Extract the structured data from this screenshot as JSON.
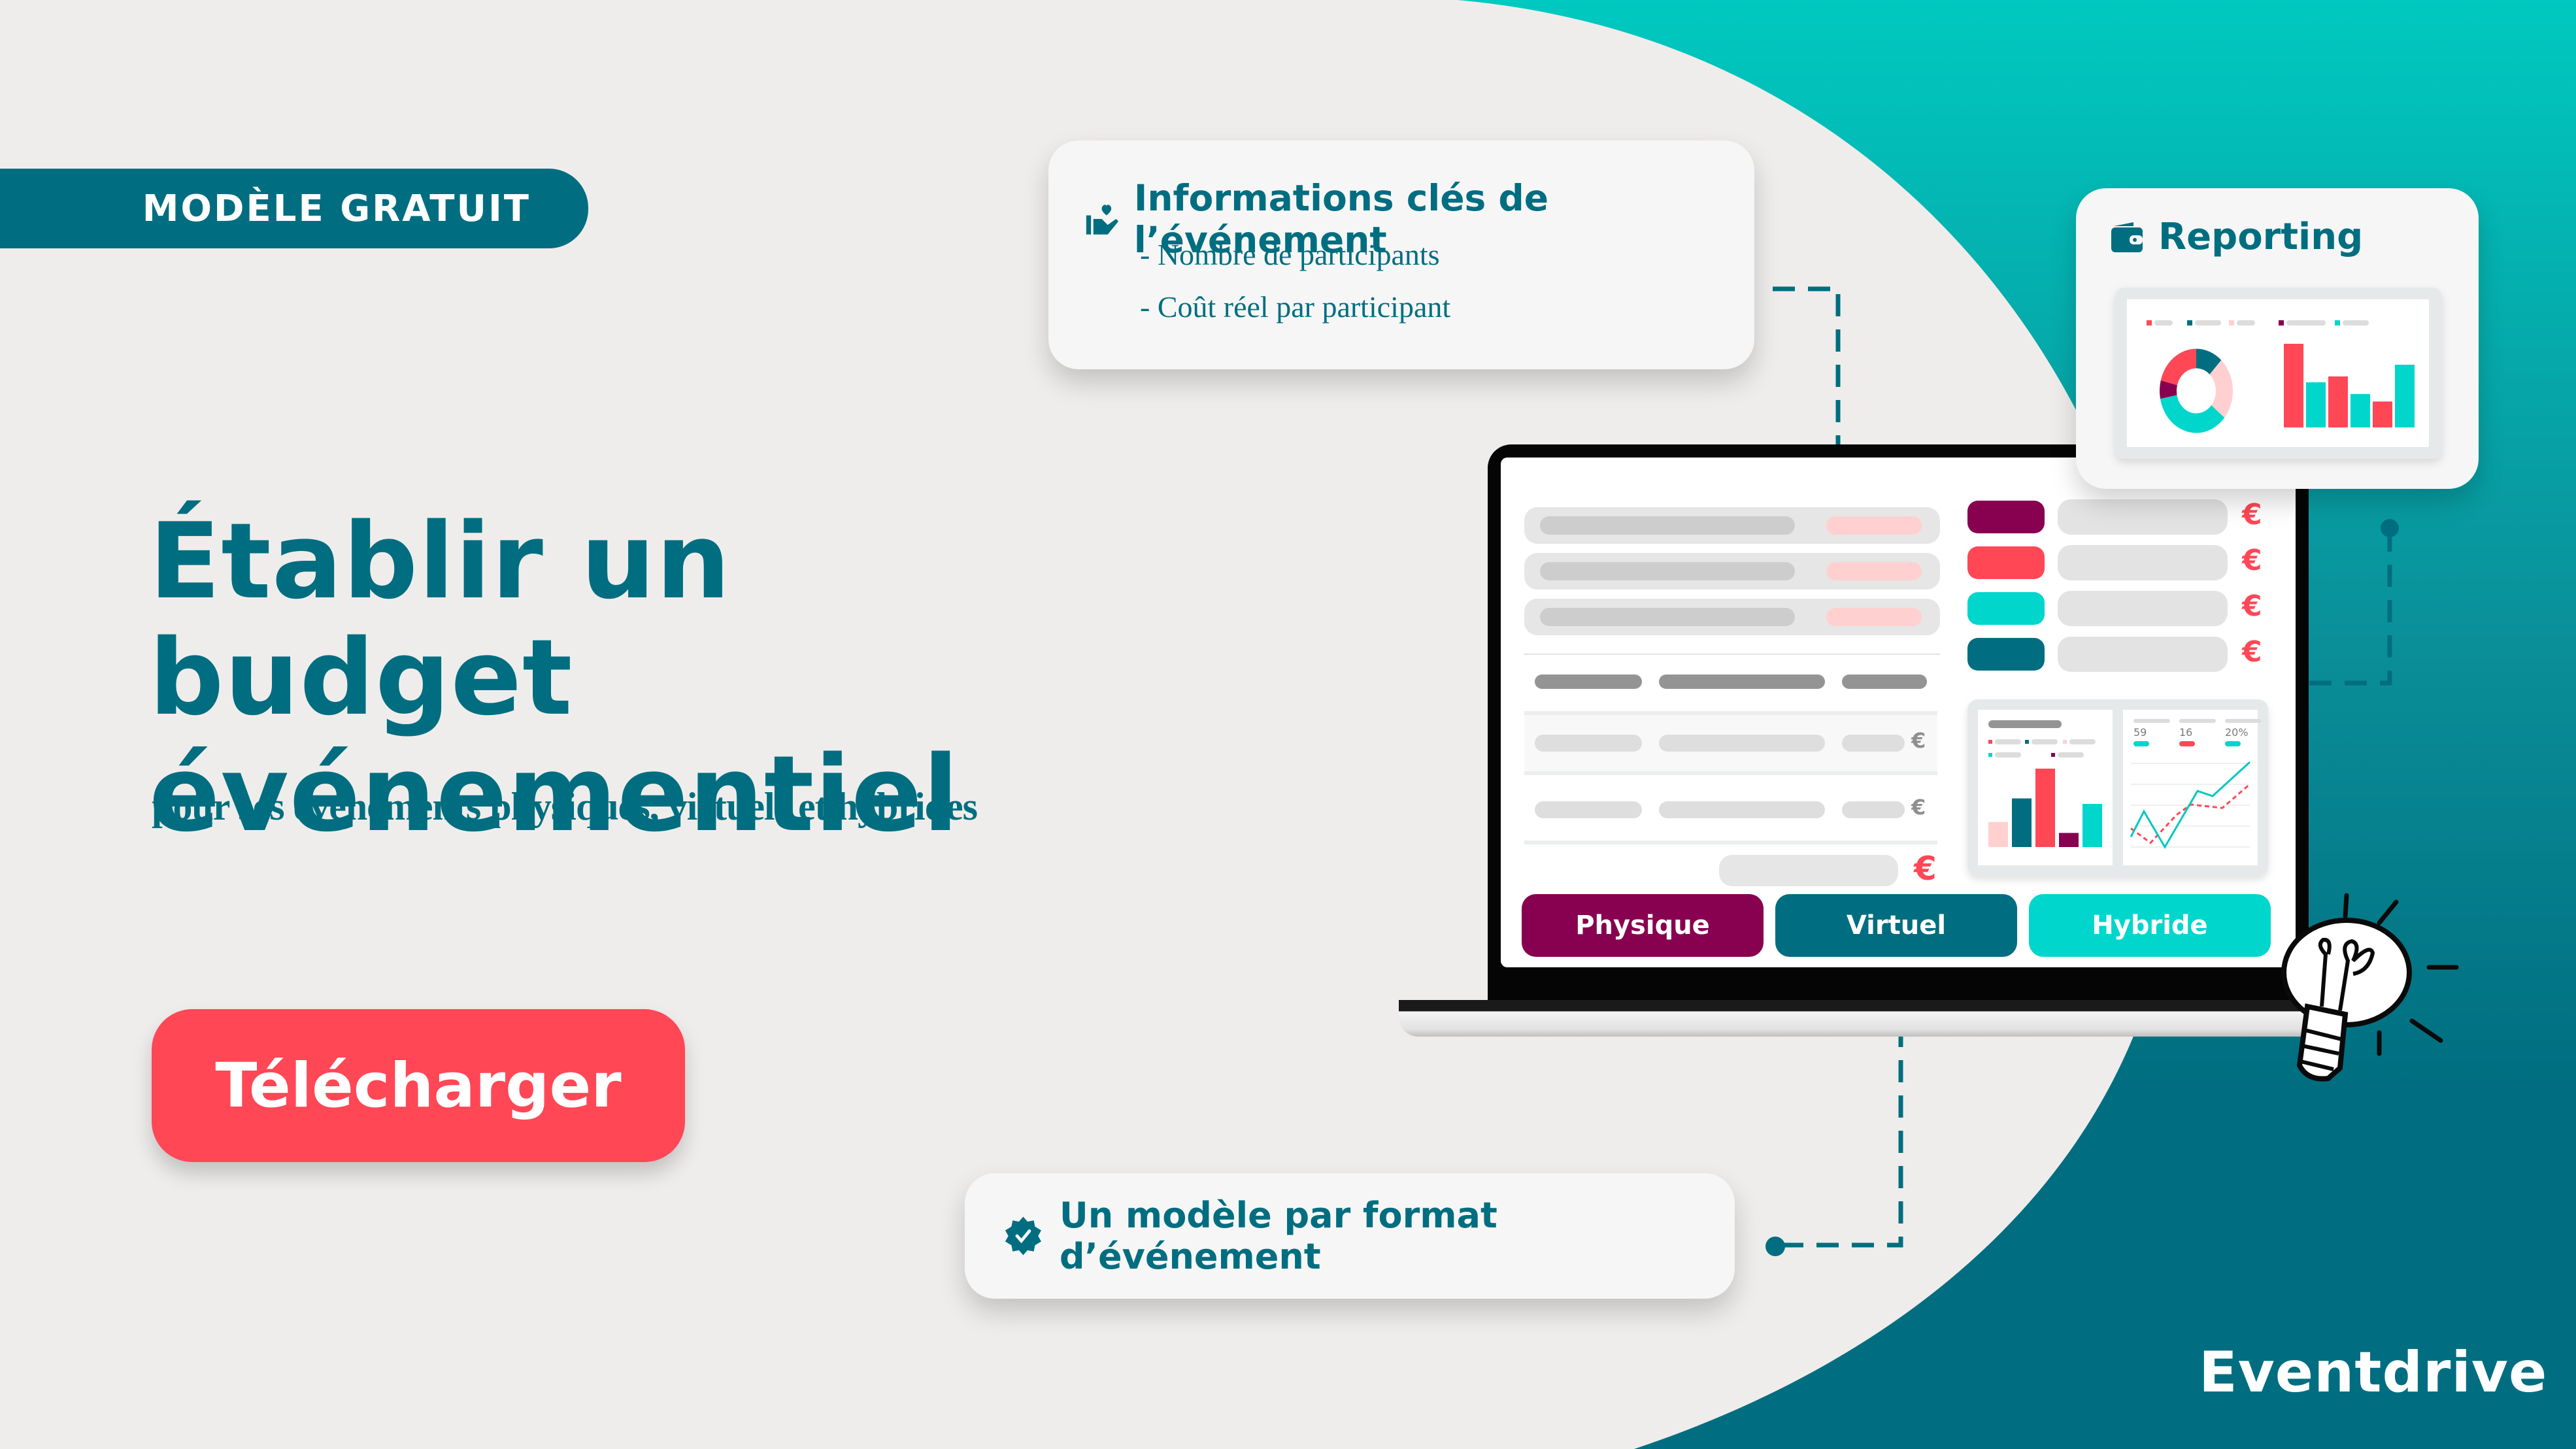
{
  "colors": {
    "teal_dark": "#006e80",
    "teal_light": "#00d6cc",
    "coral": "#ff4756",
    "plum": "#880050",
    "pink_light": "#ffd0cf",
    "paper": "#efedeb",
    "card": "#f6f6f6"
  },
  "hero": {
    "badge": "MODÈLE GRATUIT",
    "title_line1": "Établir un budget",
    "title_line2": "événementiel",
    "subtitle": "pour ses événements physiques, virtuels et hybrides",
    "cta_label": "Télécharger"
  },
  "info_card": {
    "icon": "hand-heart-icon",
    "title": "Informations clés de l’événement",
    "items": [
      "- Nombre de participants",
      "- Coût réel par participant"
    ]
  },
  "reporting_card": {
    "icon": "wallet-icon",
    "title": "Reporting",
    "donut_segments": [
      {
        "color": "#006e80",
        "share": 0.12
      },
      {
        "color": "#ffd0cf",
        "share": 0.24
      },
      {
        "color": "#00d6cc",
        "share": 0.36
      },
      {
        "color": "#880050",
        "share": 0.07
      },
      {
        "color": "#ff4756",
        "share": 0.21
      }
    ],
    "bars": [
      {
        "color": "#ff4756",
        "value": 1.0
      },
      {
        "color": "#00d6cc",
        "value": 0.54
      },
      {
        "color": "#ff4756",
        "value": 0.61
      },
      {
        "color": "#00d6cc",
        "value": 0.4
      },
      {
        "color": "#ff4756",
        "value": 0.31
      },
      {
        "color": "#00d6cc",
        "value": 0.75
      }
    ]
  },
  "laptop": {
    "currency_symbol": "€",
    "category_swatches": [
      "#880050",
      "#ff4756",
      "#00d6cc",
      "#006e80"
    ],
    "mini_bar_chart": [
      {
        "color": "#ffd0cf",
        "value": 0.32
      },
      {
        "color": "#006e80",
        "value": 0.62
      },
      {
        "color": "#ff4756",
        "value": 1.0
      },
      {
        "color": "#880050",
        "value": 0.18
      },
      {
        "color": "#00d6cc",
        "value": 0.55
      }
    ],
    "stats": [
      {
        "value": "59",
        "color": "#00d6cc"
      },
      {
        "value": "16",
        "color": "#ff4756"
      },
      {
        "value": "20%",
        "color": "#00d6cc"
      }
    ],
    "line_solid": [
      0.12,
      0.42,
      0.0,
      0.66,
      0.6,
      1.0
    ],
    "line_dashed": [
      0.22,
      0.05,
      0.38,
      0.5,
      0.46,
      0.74
    ],
    "format_buttons": [
      {
        "label": "Physique",
        "color": "#880050"
      },
      {
        "label": "Virtuel",
        "color": "#006e80"
      },
      {
        "label": "Hybride",
        "color": "#00d6cc"
      }
    ]
  },
  "format_card": {
    "icon": "check-badge-icon",
    "title": "Un modèle par format d’événement"
  },
  "brand": {
    "logo": "Eventdrive"
  }
}
